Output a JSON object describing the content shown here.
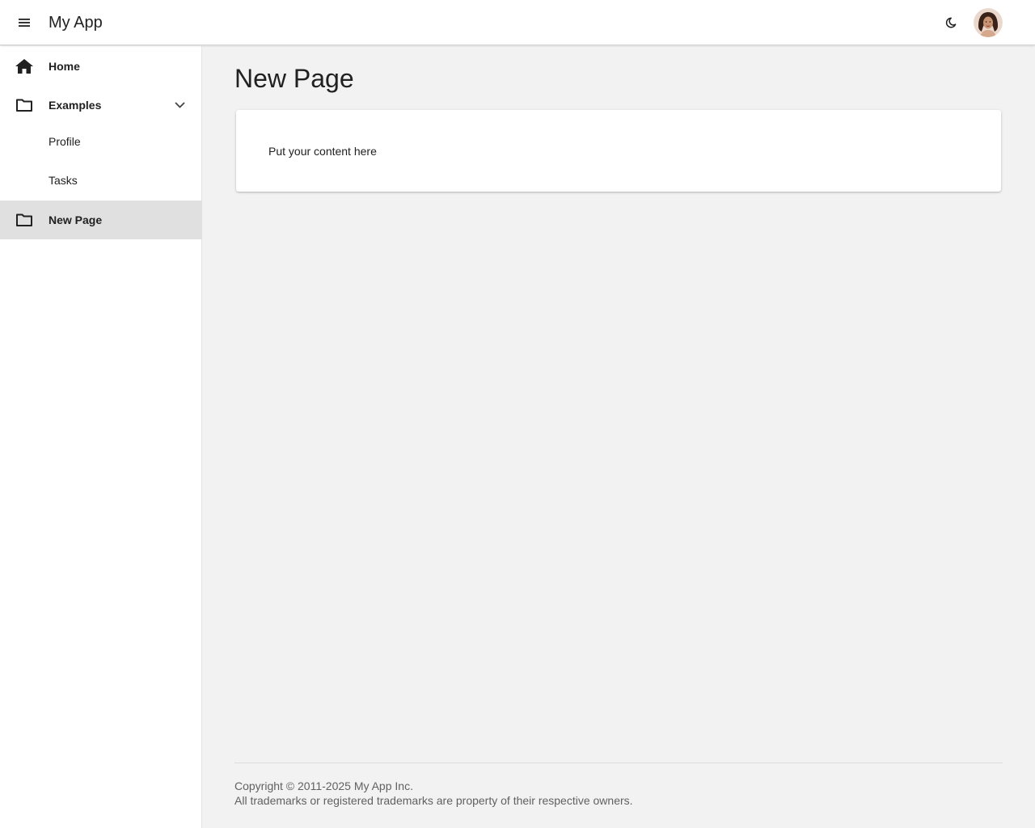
{
  "header": {
    "app_title": "My App",
    "menu_icon": "hamburger-menu-icon",
    "theme_icon": "moon-icon",
    "avatar_icon": "user-avatar"
  },
  "sidebar": {
    "items": [
      {
        "label": "Home",
        "icon": "home-icon"
      },
      {
        "label": "Examples",
        "icon": "folder-icon",
        "expanded": true,
        "children": [
          {
            "label": "Profile"
          },
          {
            "label": "Tasks"
          }
        ]
      },
      {
        "label": "New Page",
        "icon": "folder-icon",
        "active": true
      }
    ]
  },
  "main": {
    "page_title": "New Page",
    "card_text": "Put your content here"
  },
  "footer": {
    "copyright": "Copyright © 2011-2025 My App Inc.",
    "trademarks": "All trademarks or registered trademarks are property of their respective owners."
  },
  "colors": {
    "header_bg": "#ffffff",
    "content_bg": "#f2f2f2",
    "active_item_bg": "#e0e0e0",
    "text": "#212121",
    "footer_text": "#616161"
  }
}
